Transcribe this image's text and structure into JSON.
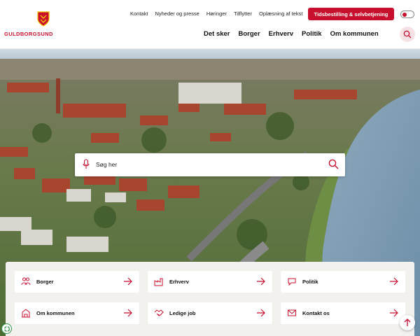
{
  "logo": {
    "text": "GULDBORGSUND",
    "icon": "coat-of-arms-icon"
  },
  "topnav": {
    "items": [
      "Kontakt",
      "Nyheder og presse",
      "Høringer",
      "Tilflytter",
      "Oplæsning af tekst"
    ]
  },
  "cta": {
    "label": "Tidsbestilling & selvbetjening"
  },
  "mainnav": {
    "items": [
      "Det sker",
      "Borger",
      "Erhverv",
      "Politik",
      "Om kommunen"
    ]
  },
  "search": {
    "placeholder": "Søg her",
    "mic_icon": "microphone-icon",
    "search_icon": "search-icon"
  },
  "tiles": [
    {
      "label": "Borger",
      "icon": "people-icon"
    },
    {
      "label": "Erhverv",
      "icon": "factory-icon"
    },
    {
      "label": "Politik",
      "icon": "speech-bubble-icon"
    },
    {
      "label": "Om kommunen",
      "icon": "town-hall-icon"
    },
    {
      "label": "Ledige job",
      "icon": "handshake-icon"
    },
    {
      "label": "Kontakt os",
      "icon": "envelope-icon"
    }
  ],
  "colors": {
    "brand": "#c8102e",
    "panel": "#f3f1ee",
    "water": "#7f9fb8"
  }
}
